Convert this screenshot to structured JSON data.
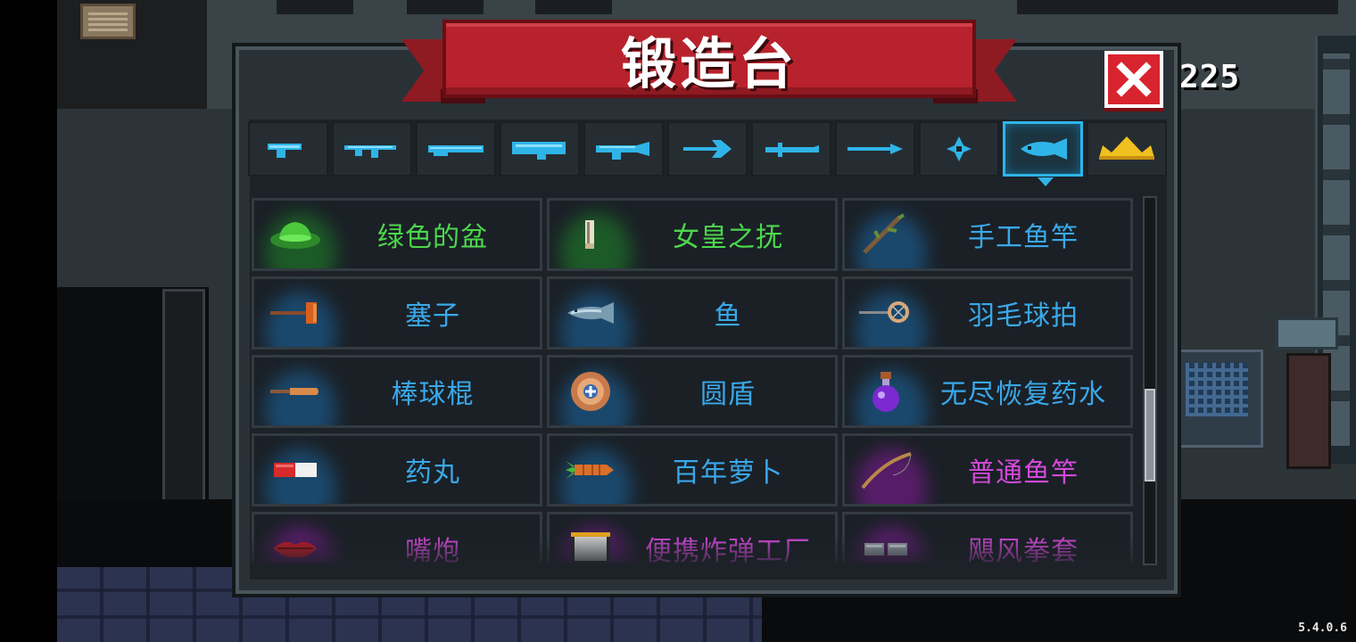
{
  "title": "锻造台",
  "currency_amount": "225",
  "version": "5.4.0.6",
  "colors": {
    "green_text": "#4cd84c",
    "blue_text": "#3aa8e8",
    "purple_text": "#d24ad8",
    "active_tab_border": "#2fb4e8",
    "banner_red": "#b8222c"
  },
  "tabs": [
    {
      "icon": "pistol-icon",
      "active": false
    },
    {
      "icon": "assault-rifle-icon",
      "active": false
    },
    {
      "icon": "shotgun-icon",
      "active": false
    },
    {
      "icon": "rocket-launcher-icon",
      "active": false
    },
    {
      "icon": "laser-rifle-icon",
      "active": false
    },
    {
      "icon": "bow-icon",
      "active": false
    },
    {
      "icon": "sword-icon",
      "active": false
    },
    {
      "icon": "spear-icon",
      "active": false
    },
    {
      "icon": "shuriken-icon",
      "active": false
    },
    {
      "icon": "fish-icon",
      "active": true
    },
    {
      "icon": "crown-icon",
      "active": false
    }
  ],
  "items": [
    {
      "name": "绿色的盆",
      "rarity": "green",
      "icon": "green-basin-icon"
    },
    {
      "name": "女皇之抚",
      "rarity": "green",
      "icon": "queen-caress-icon"
    },
    {
      "name": "手工鱼竿",
      "rarity": "blue",
      "icon": "handmade-fishing-rod-icon"
    },
    {
      "name": "塞子",
      "rarity": "blue",
      "icon": "plunger-icon"
    },
    {
      "name": "鱼",
      "rarity": "blue",
      "icon": "fish-icon"
    },
    {
      "name": "羽毛球拍",
      "rarity": "blue",
      "icon": "badminton-racket-icon"
    },
    {
      "name": "棒球棍",
      "rarity": "blue",
      "icon": "baseball-bat-icon"
    },
    {
      "name": "圆盾",
      "rarity": "blue",
      "icon": "round-shield-icon"
    },
    {
      "name": "无尽恢复药水",
      "rarity": "blue",
      "icon": "potion-icon"
    },
    {
      "name": "药丸",
      "rarity": "blue",
      "icon": "pill-icon"
    },
    {
      "name": "百年萝卜",
      "rarity": "blue",
      "icon": "carrot-icon"
    },
    {
      "name": "普通鱼竿",
      "rarity": "purple",
      "icon": "fishing-rod-icon"
    },
    {
      "name": "嘴炮",
      "rarity": "purple",
      "icon": "lips-icon"
    },
    {
      "name": "便携炸弹工厂",
      "rarity": "purple",
      "icon": "bomb-factory-icon"
    },
    {
      "name": "飓风拳套",
      "rarity": "purple",
      "icon": "hurricane-gauntlet-icon"
    }
  ]
}
